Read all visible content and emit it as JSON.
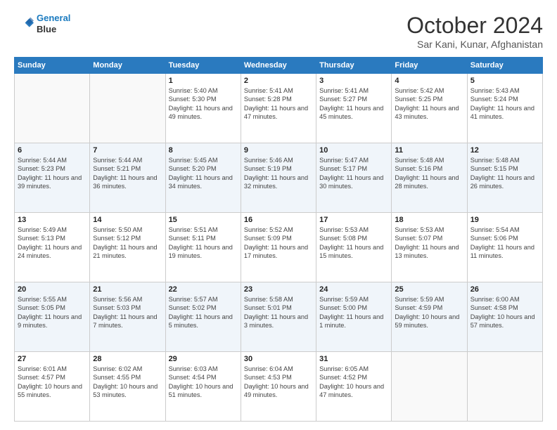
{
  "header": {
    "logo_line1": "General",
    "logo_line2": "Blue",
    "title": "October 2024",
    "subtitle": "Sar Kani, Kunar, Afghanistan"
  },
  "days": [
    "Sunday",
    "Monday",
    "Tuesday",
    "Wednesday",
    "Thursday",
    "Friday",
    "Saturday"
  ],
  "weeks": [
    [
      {
        "date": "",
        "info": ""
      },
      {
        "date": "",
        "info": ""
      },
      {
        "date": "1",
        "info": "Sunrise: 5:40 AM\nSunset: 5:30 PM\nDaylight: 11 hours and 49 minutes."
      },
      {
        "date": "2",
        "info": "Sunrise: 5:41 AM\nSunset: 5:28 PM\nDaylight: 11 hours and 47 minutes."
      },
      {
        "date": "3",
        "info": "Sunrise: 5:41 AM\nSunset: 5:27 PM\nDaylight: 11 hours and 45 minutes."
      },
      {
        "date": "4",
        "info": "Sunrise: 5:42 AM\nSunset: 5:25 PM\nDaylight: 11 hours and 43 minutes."
      },
      {
        "date": "5",
        "info": "Sunrise: 5:43 AM\nSunset: 5:24 PM\nDaylight: 11 hours and 41 minutes."
      }
    ],
    [
      {
        "date": "6",
        "info": "Sunrise: 5:44 AM\nSunset: 5:23 PM\nDaylight: 11 hours and 39 minutes."
      },
      {
        "date": "7",
        "info": "Sunrise: 5:44 AM\nSunset: 5:21 PM\nDaylight: 11 hours and 36 minutes."
      },
      {
        "date": "8",
        "info": "Sunrise: 5:45 AM\nSunset: 5:20 PM\nDaylight: 11 hours and 34 minutes."
      },
      {
        "date": "9",
        "info": "Sunrise: 5:46 AM\nSunset: 5:19 PM\nDaylight: 11 hours and 32 minutes."
      },
      {
        "date": "10",
        "info": "Sunrise: 5:47 AM\nSunset: 5:17 PM\nDaylight: 11 hours and 30 minutes."
      },
      {
        "date": "11",
        "info": "Sunrise: 5:48 AM\nSunset: 5:16 PM\nDaylight: 11 hours and 28 minutes."
      },
      {
        "date": "12",
        "info": "Sunrise: 5:48 AM\nSunset: 5:15 PM\nDaylight: 11 hours and 26 minutes."
      }
    ],
    [
      {
        "date": "13",
        "info": "Sunrise: 5:49 AM\nSunset: 5:13 PM\nDaylight: 11 hours and 24 minutes."
      },
      {
        "date": "14",
        "info": "Sunrise: 5:50 AM\nSunset: 5:12 PM\nDaylight: 11 hours and 21 minutes."
      },
      {
        "date": "15",
        "info": "Sunrise: 5:51 AM\nSunset: 5:11 PM\nDaylight: 11 hours and 19 minutes."
      },
      {
        "date": "16",
        "info": "Sunrise: 5:52 AM\nSunset: 5:09 PM\nDaylight: 11 hours and 17 minutes."
      },
      {
        "date": "17",
        "info": "Sunrise: 5:53 AM\nSunset: 5:08 PM\nDaylight: 11 hours and 15 minutes."
      },
      {
        "date": "18",
        "info": "Sunrise: 5:53 AM\nSunset: 5:07 PM\nDaylight: 11 hours and 13 minutes."
      },
      {
        "date": "19",
        "info": "Sunrise: 5:54 AM\nSunset: 5:06 PM\nDaylight: 11 hours and 11 minutes."
      }
    ],
    [
      {
        "date": "20",
        "info": "Sunrise: 5:55 AM\nSunset: 5:05 PM\nDaylight: 11 hours and 9 minutes."
      },
      {
        "date": "21",
        "info": "Sunrise: 5:56 AM\nSunset: 5:03 PM\nDaylight: 11 hours and 7 minutes."
      },
      {
        "date": "22",
        "info": "Sunrise: 5:57 AM\nSunset: 5:02 PM\nDaylight: 11 hours and 5 minutes."
      },
      {
        "date": "23",
        "info": "Sunrise: 5:58 AM\nSunset: 5:01 PM\nDaylight: 11 hours and 3 minutes."
      },
      {
        "date": "24",
        "info": "Sunrise: 5:59 AM\nSunset: 5:00 PM\nDaylight: 11 hours and 1 minute."
      },
      {
        "date": "25",
        "info": "Sunrise: 5:59 AM\nSunset: 4:59 PM\nDaylight: 10 hours and 59 minutes."
      },
      {
        "date": "26",
        "info": "Sunrise: 6:00 AM\nSunset: 4:58 PM\nDaylight: 10 hours and 57 minutes."
      }
    ],
    [
      {
        "date": "27",
        "info": "Sunrise: 6:01 AM\nSunset: 4:57 PM\nDaylight: 10 hours and 55 minutes."
      },
      {
        "date": "28",
        "info": "Sunrise: 6:02 AM\nSunset: 4:55 PM\nDaylight: 10 hours and 53 minutes."
      },
      {
        "date": "29",
        "info": "Sunrise: 6:03 AM\nSunset: 4:54 PM\nDaylight: 10 hours and 51 minutes."
      },
      {
        "date": "30",
        "info": "Sunrise: 6:04 AM\nSunset: 4:53 PM\nDaylight: 10 hours and 49 minutes."
      },
      {
        "date": "31",
        "info": "Sunrise: 6:05 AM\nSunset: 4:52 PM\nDaylight: 10 hours and 47 minutes."
      },
      {
        "date": "",
        "info": ""
      },
      {
        "date": "",
        "info": ""
      }
    ]
  ]
}
